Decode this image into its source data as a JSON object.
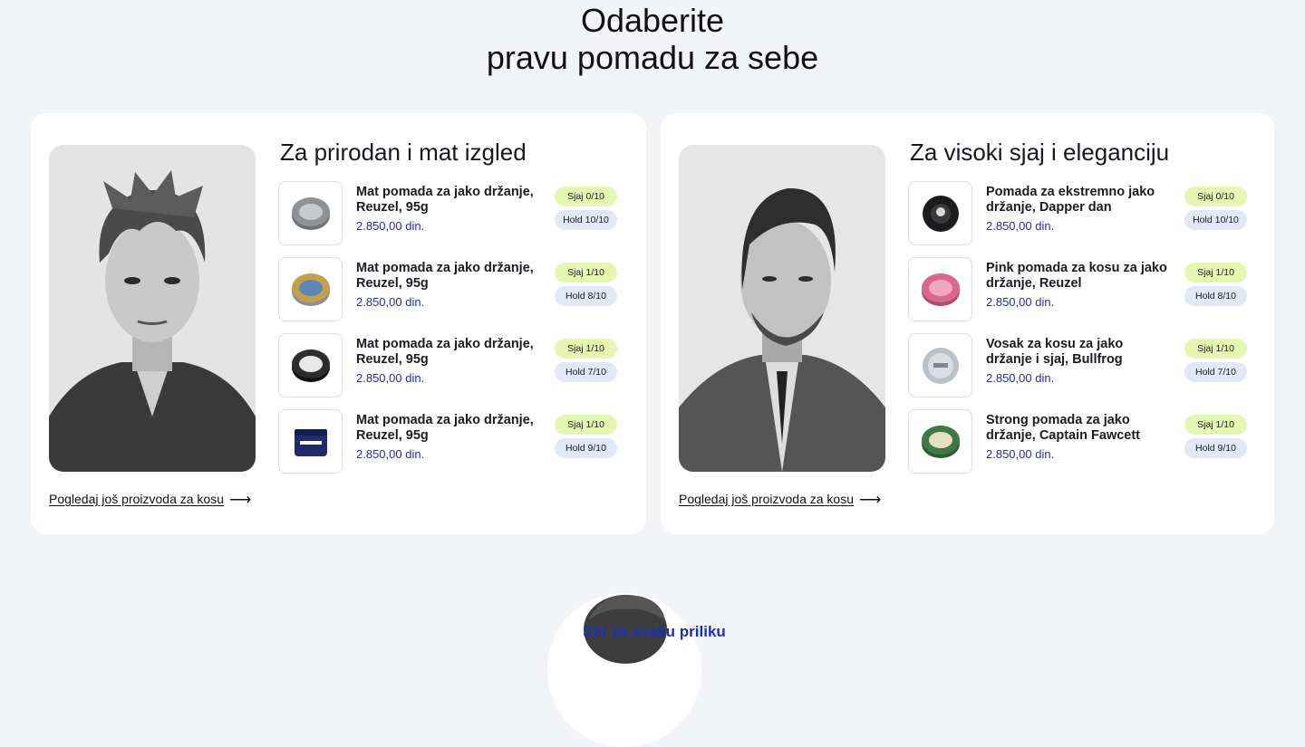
{
  "heading": {
    "line1": "Odaberite",
    "line2": "pravu pomadu za sebe"
  },
  "cards": [
    {
      "title": "Za prirodan i mat izgled",
      "link_label": "Pogledaj još proizvoda za kosu",
      "link_icon": "arrow-right-icon",
      "portrait": "man-messy-hair-photo",
      "products": [
        {
          "name": "Mat pomada za jako držanje, Reuzel, 95g",
          "price": "2.850,00 din.",
          "shine": "Sjaj 0/10",
          "hold": "Hold 10/10",
          "tin_color": "#8e9295"
        },
        {
          "name": "Mat pomada za jako držanje, Reuzel, 95g",
          "price": "2.850,00 din.",
          "shine": "Sjaj 1/10",
          "hold": "Hold 8/10",
          "tin_color": "#c2a04c"
        },
        {
          "name": "Mat pomada za jako držanje, Reuzel, 95g",
          "price": "2.850,00 din.",
          "shine": "Sjaj 1/10",
          "hold": "Hold 7/10",
          "tin_color": "#2d2d2f"
        },
        {
          "name": "Mat pomada za jako držanje, Reuzel, 95g",
          "price": "2.850,00 din.",
          "shine": "Sjaj 1/10",
          "hold": "Hold 9/10",
          "tin_color": "#1d2a6b"
        }
      ]
    },
    {
      "title": "Za visoki sjaj i eleganciju",
      "link_label": "Pogledaj još proizvoda za kosu",
      "link_icon": "arrow-right-icon",
      "portrait": "man-slicked-hair-suit-photo",
      "products": [
        {
          "name": "Pomada za ekstremno jako držanje, Dapper dan",
          "price": "2.850,00 din.",
          "shine": "Sjaj 0/10",
          "hold": "Hold 10/10",
          "tin_color": "#1c1c1e"
        },
        {
          "name": "Pink pomada za kosu za jako držanje, Reuzel",
          "price": "2.850,00 din.",
          "shine": "Sjaj 1/10",
          "hold": "Hold 8/10",
          "tin_color": "#d9688f"
        },
        {
          "name": "Vosak za kosu za jako držanje i sjaj, Bullfrog",
          "price": "2.850,00 din.",
          "shine": "Sjaj 1/10",
          "hold": "Hold 7/10",
          "tin_color": "#b9c2cb"
        },
        {
          "name": "Strong pomada za jako držanje, Captain Fawcett",
          "price": "2.850,00 din.",
          "shine": "Sjaj 1/10",
          "hold": "Hold 9/10",
          "tin_color": "#3f7a46"
        }
      ]
    }
  ],
  "next_section": {
    "caption": "Stil za svaku priliku"
  },
  "colors": {
    "background": "#f3f4f7",
    "price_blue": "#1d2fb3",
    "shine_badge": "#e6f7b4",
    "hold_badge": "#e1e9f7"
  }
}
